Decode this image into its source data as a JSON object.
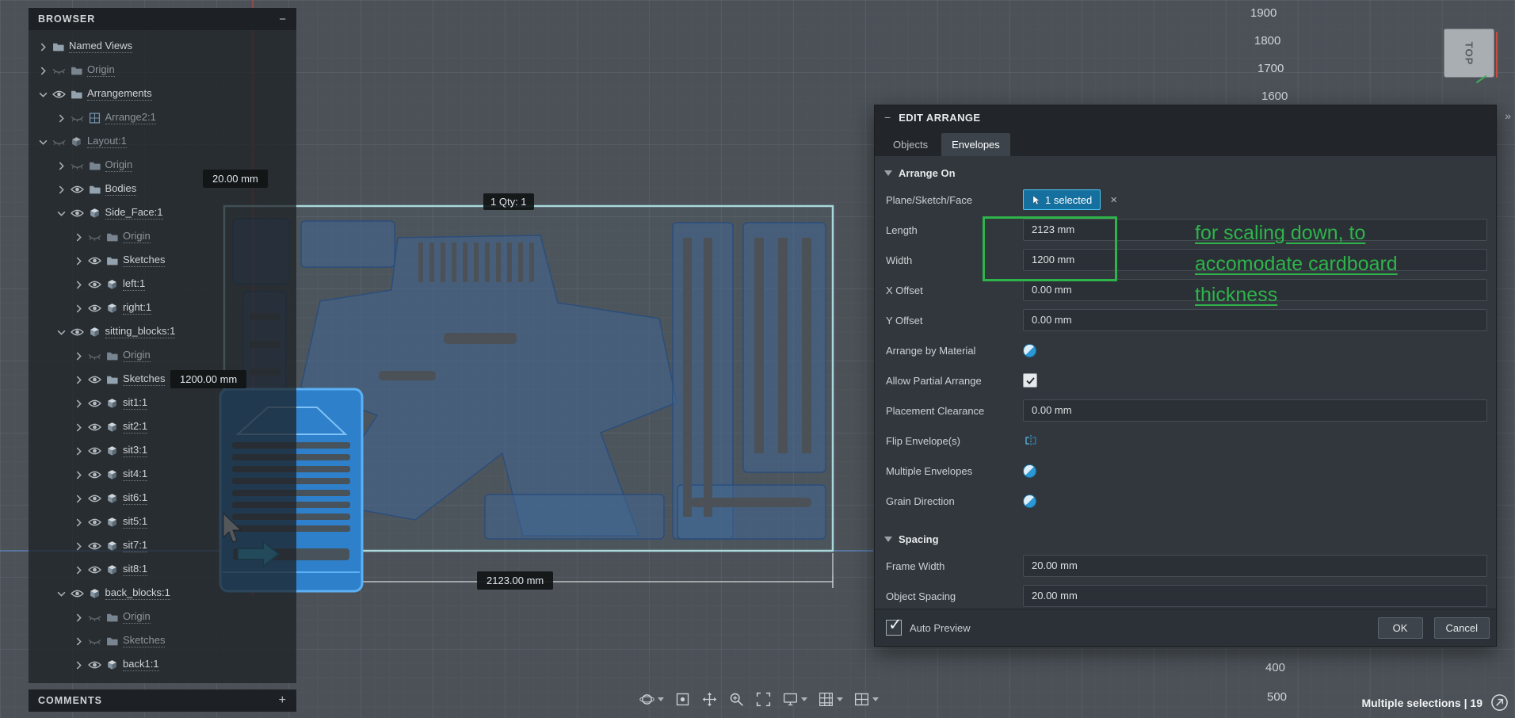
{
  "glyphs": {
    "minimize": "−",
    "plus": "+",
    "expand": "»",
    "clear": "×"
  },
  "colors": {
    "accent_green": "#2eb44b",
    "selection_blue": "#156f9f",
    "part_blue": "#2f80ca",
    "envelope_teal": "#a9d8dc"
  },
  "browser": {
    "title": "BROWSER",
    "items": [
      {
        "label": "Named Views",
        "level": 0,
        "chevron": "right",
        "icon": "folder"
      },
      {
        "label": "Origin",
        "level": 0,
        "chevron": "right",
        "icon": "folder",
        "eye": "hidden"
      },
      {
        "label": "Arrangements",
        "level": 0,
        "chevron": "down",
        "icon": "folder",
        "eye": "visible"
      },
      {
        "label": "Arrange2:1",
        "level": 1,
        "chevron": "right",
        "icon": "arrange",
        "eye": "hidden"
      },
      {
        "label": "Layout:1",
        "level": 0,
        "chevron": "down",
        "icon": "component",
        "eye": "hidden"
      },
      {
        "label": "Origin",
        "level": 1,
        "chevron": "right",
        "icon": "folder",
        "eye": "hidden"
      },
      {
        "label": "Bodies",
        "level": 1,
        "chevron": "right",
        "icon": "folder",
        "eye": "visible"
      },
      {
        "label": "Side_Face:1",
        "level": 1,
        "chevron": "down",
        "icon": "component",
        "eye": "visible"
      },
      {
        "label": "Origin",
        "level": 2,
        "chevron": "right",
        "icon": "folder",
        "eye": "hidden"
      },
      {
        "label": "Sketches",
        "level": 2,
        "chevron": "right",
        "icon": "folder",
        "eye": "visible"
      },
      {
        "label": "left:1",
        "level": 2,
        "chevron": "right",
        "icon": "component",
        "eye": "visible"
      },
      {
        "label": "right:1",
        "level": 2,
        "chevron": "right",
        "icon": "component",
        "eye": "visible"
      },
      {
        "label": "sitting_blocks:1",
        "level": 1,
        "chevron": "down",
        "icon": "component",
        "eye": "visible"
      },
      {
        "label": "Origin",
        "level": 2,
        "chevron": "right",
        "icon": "folder",
        "eye": "hidden"
      },
      {
        "label": "Sketches",
        "level": 2,
        "chevron": "right",
        "icon": "folder",
        "eye": "visible"
      },
      {
        "label": "sit1:1",
        "level": 2,
        "chevron": "right",
        "icon": "component",
        "eye": "visible"
      },
      {
        "label": "sit2:1",
        "level": 2,
        "chevron": "right",
        "icon": "component",
        "eye": "visible"
      },
      {
        "label": "sit3:1",
        "level": 2,
        "chevron": "right",
        "icon": "component",
        "eye": "visible"
      },
      {
        "label": "sit4:1",
        "level": 2,
        "chevron": "right",
        "icon": "component",
        "eye": "visible"
      },
      {
        "label": "sit6:1",
        "level": 2,
        "chevron": "right",
        "icon": "component",
        "eye": "visible"
      },
      {
        "label": "sit5:1",
        "level": 2,
        "chevron": "right",
        "icon": "component",
        "eye": "visible"
      },
      {
        "label": "sit7:1",
        "level": 2,
        "chevron": "right",
        "icon": "component",
        "eye": "visible"
      },
      {
        "label": "sit8:1",
        "level": 2,
        "chevron": "right",
        "icon": "component",
        "eye": "visible"
      },
      {
        "label": "back_blocks:1",
        "level": 1,
        "chevron": "down",
        "icon": "component",
        "eye": "visible"
      },
      {
        "label": "Origin",
        "level": 2,
        "chevron": "right",
        "icon": "folder",
        "eye": "hidden"
      },
      {
        "label": "Sketches",
        "level": 2,
        "chevron": "right",
        "icon": "folder",
        "eye": "hidden"
      },
      {
        "label": "back1:1",
        "level": 2,
        "chevron": "right",
        "icon": "component",
        "eye": "visible"
      }
    ]
  },
  "comments": {
    "title": "COMMENTS"
  },
  "canvas": {
    "labels": {
      "frame_width": "20.00 mm",
      "qty": "1 Qty: 1",
      "height": "1200.00 mm",
      "width": "2123.00 mm"
    },
    "annotation_lines": [
      "for scaling down, to",
      "accomodate cardboard",
      "thickness"
    ],
    "ruler_top": [
      "1900",
      "1800",
      "1700",
      "1600"
    ],
    "ruler_bottom": [
      "400",
      "500"
    ],
    "viewcube_label": "TOP"
  },
  "dialog": {
    "title": "EDIT ARRANGE",
    "tabs": [
      {
        "label": "Objects",
        "active": false
      },
      {
        "label": "Envelopes",
        "active": true
      }
    ],
    "sections": [
      {
        "title": "Arrange On",
        "rows": [
          {
            "label": "Plane/Sketch/Face",
            "type": "selection",
            "value": "1 selected"
          },
          {
            "label": "Length",
            "type": "input",
            "value": "2123 mm"
          },
          {
            "label": "Width",
            "type": "input",
            "value": "1200 mm"
          },
          {
            "label": "X Offset",
            "type": "input",
            "value": "0.00 mm"
          },
          {
            "label": "Y Offset",
            "type": "input",
            "value": "0.00 mm"
          },
          {
            "label": "Arrange by Material",
            "type": "toggle"
          },
          {
            "label": "Allow Partial Arrange",
            "type": "checkbox",
            "checked": true
          },
          {
            "label": "Placement Clearance",
            "type": "input",
            "value": "0.00 mm"
          },
          {
            "label": "Flip Envelope(s)",
            "type": "flip"
          },
          {
            "label": "Multiple Envelopes",
            "type": "toggle"
          },
          {
            "label": "Grain Direction",
            "type": "toggle"
          }
        ]
      },
      {
        "title": "Spacing",
        "rows": [
          {
            "label": "Frame Width",
            "type": "input",
            "value": "20.00 mm"
          },
          {
            "label": "Object Spacing",
            "type": "input",
            "value": "20.00 mm"
          }
        ]
      }
    ],
    "footer": {
      "auto_preview": "Auto Preview",
      "ok": "OK",
      "cancel": "Cancel"
    }
  },
  "toolbar": {
    "items": [
      {
        "name": "orbit-icon",
        "caret": true
      },
      {
        "name": "look-at-icon",
        "caret": false
      },
      {
        "name": "pan-icon",
        "caret": false
      },
      {
        "name": "zoom-icon",
        "caret": false
      },
      {
        "name": "fit-icon",
        "caret": false
      },
      {
        "name": "display-settings-icon",
        "caret": true
      },
      {
        "name": "grid-settings-icon",
        "caret": true
      },
      {
        "name": "viewports-icon",
        "caret": true
      }
    ]
  },
  "status": {
    "selection_text": "Multiple selections | 19"
  }
}
